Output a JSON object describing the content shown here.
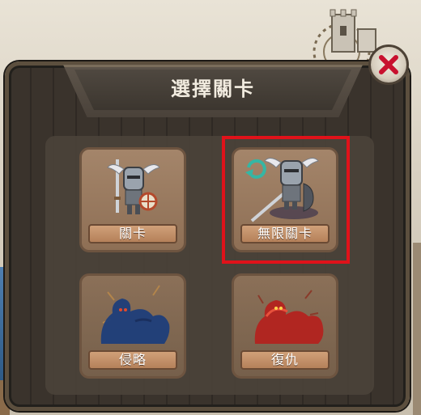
{
  "dialog": {
    "title": "選擇關卡",
    "close_icon": "close-x-icon"
  },
  "colors": {
    "highlight": "#e0121a",
    "close_x": "#c8102e",
    "tile_label": "#c4916a"
  },
  "levels": [
    {
      "label": "關卡",
      "icon": "knight-icon",
      "selected": false
    },
    {
      "label": "無限關卡",
      "icon": "knight-refresh-icon",
      "selected": true
    },
    {
      "label": "侵略",
      "icon": "blue-monster-silhouette-icon",
      "selected": false
    },
    {
      "label": "復仇",
      "icon": "red-monster-silhouette-icon",
      "selected": false
    }
  ]
}
